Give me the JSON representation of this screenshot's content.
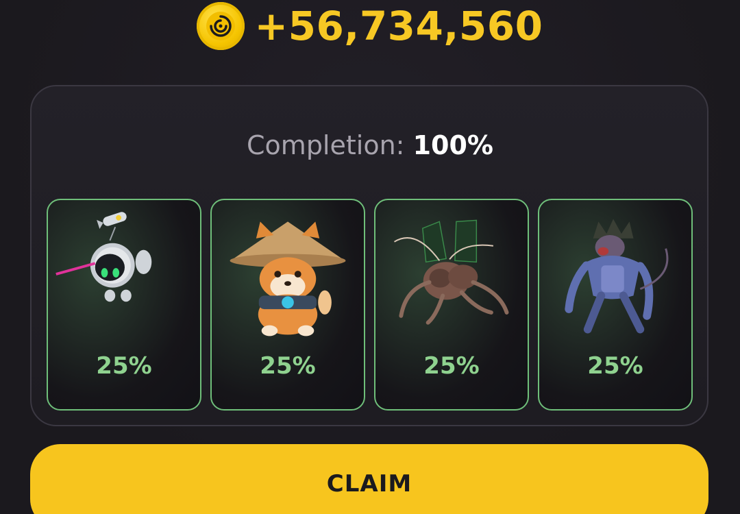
{
  "reward": {
    "amount": "+56,734,560",
    "coin_icon": "coin-icon",
    "color": "#f7c824"
  },
  "completion": {
    "label": "Completion:",
    "value": "100%"
  },
  "cards": [
    {
      "name": "robot",
      "percent": "25%",
      "icon": "robot-drone-icon"
    },
    {
      "name": "shiba",
      "percent": "25%",
      "icon": "shiba-dog-icon"
    },
    {
      "name": "insect",
      "percent": "25%",
      "icon": "mech-insect-icon"
    },
    {
      "name": "beast",
      "percent": "25%",
      "icon": "cyber-beast-icon"
    }
  ],
  "claim": {
    "label": "CLAIM",
    "color": "#f7c51e"
  },
  "colors": {
    "card_border": "#6fbf7a",
    "percent": "#8fd28f",
    "background": "#1c1a20"
  }
}
